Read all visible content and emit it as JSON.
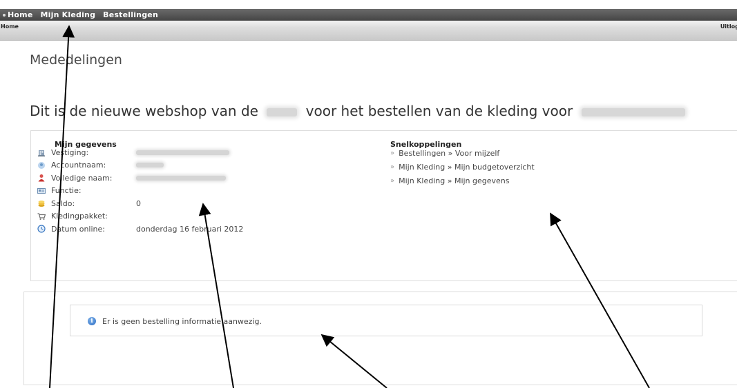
{
  "topnav": {
    "items": [
      "Home",
      "Mijn Kleding",
      "Bestellingen"
    ]
  },
  "subbar": {
    "breadcrumb": "Home",
    "logout": "Uitlogge"
  },
  "page_title": "Mededelingen",
  "intro": {
    "text_before": "Dit is de nieuwe webshop van de",
    "text_middle": "voor het bestellen van de kleding voor"
  },
  "details": {
    "heading": "Mijn gegevens",
    "rows": [
      {
        "icon": "building-icon",
        "label": "Vestiging:",
        "value": ""
      },
      {
        "icon": "account-icon",
        "label": "Accountnaam:",
        "value": ""
      },
      {
        "icon": "person-icon",
        "label": "Volledige naam:",
        "value": ""
      },
      {
        "icon": "id-card-icon",
        "label": "Functie:",
        "value": ""
      },
      {
        "icon": "coins-icon",
        "label": "Saldo:",
        "value": "0"
      },
      {
        "icon": "cart-icon",
        "label": "Kledingpakket:",
        "value": ""
      },
      {
        "icon": "clock-icon",
        "label": "Datum online:",
        "value": "donderdag 16 februari 2012"
      }
    ]
  },
  "shortcuts": {
    "heading": "Snelkoppelingen",
    "links": [
      "Bestellingen » Voor mijzelf",
      "Mijn Kleding » Mijn budgetoverzicht",
      "Mijn Kleding » Mijn gegevens"
    ]
  },
  "info": {
    "icon": "info-icon",
    "message": "Er is geen bestelling informatie aanwezig."
  },
  "colors": {
    "topnav": "#454545",
    "subbar": "#d6d6d6",
    "arrow": "#000000"
  }
}
